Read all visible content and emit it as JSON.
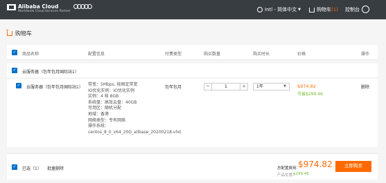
{
  "topbar": {
    "brand": "Alibaba Cloud",
    "brand_sub": "Worldwide Cloud Services Partner",
    "language": "Intl - 简体中文",
    "cart_label": "购物车",
    "cart_count": "(1)",
    "console": "控制台",
    "bg_color": "#373d41"
  },
  "page": {
    "title": "购物车"
  },
  "header": {
    "product_name": "商品名称",
    "config": "配置信息",
    "pay_type": "付费类型",
    "quantity": "购买数量",
    "duration": "购买时长",
    "price": "价格",
    "action": "操作"
  },
  "group": {
    "label": "云服务器（包年包月国际站1）"
  },
  "item": {
    "name": "云服务器（包年包月国际站1）",
    "config": [
      "带宽：5Mbps, 按固定带宽",
      "IO优化实例：IO优化实例",
      "实例：4 核 8GB",
      "系统盘：高效云盘：40GB",
      "可用区：随机分配",
      "地域：香港",
      "网络类型：专有网络",
      "操作系统：",
      "centos_8_0_x64_20G_alibase_20200218.vhd"
    ],
    "pay_type": "包年包月",
    "quantity": "1",
    "duration": "1年",
    "price": "$974.82",
    "saving": "节省$299.46",
    "delete": "删除"
  },
  "footer": {
    "selected": "已选（1）",
    "batch_delete": "批量删除",
    "total_label": "总配置费用：",
    "total_price": "$974.82",
    "saving_label": "产品优惠：",
    "saving": "$299.46",
    "buy": "立即购买"
  },
  "colors": {
    "accent": "#ff6a00",
    "checkbox": "#0070cc",
    "saving": "#6fba2c"
  }
}
